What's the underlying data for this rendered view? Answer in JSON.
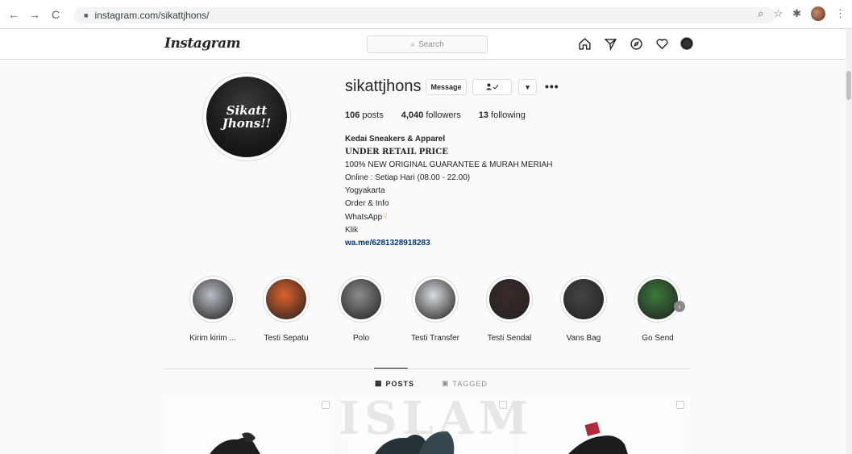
{
  "browser": {
    "url": "instagram.com/sikattjhons/"
  },
  "ig": {
    "logo": "Instagram",
    "search_placeholder": "Search"
  },
  "profile": {
    "username": "sikattjhons",
    "pic_text_line1": "Sikatt",
    "pic_text_line2": "Jhons!!",
    "message_label": "Message",
    "posts_count": "106",
    "posts_label": "posts",
    "followers_count": "4,040",
    "followers_label": "followers",
    "following_count": "13",
    "following_label": "following",
    "bio": {
      "name": "Kedai Sneakers & Apparel",
      "line1": "UNDER RETAIL PRICE",
      "line2": "100% NEW ORIGINAL GUARANTEE & MURAH MERIAH",
      "line3": "Online : Setiap Hari (08.00 - 22.00)",
      "line4": "Yogyakarta",
      "line5": "Order & Info",
      "line6": "WhatsApp",
      "line7": "Klik",
      "link": "wa.me/6281328918283"
    }
  },
  "highlights": [
    {
      "label": "Kirim kirim ...",
      "color": "#b9bec4"
    },
    {
      "label": "Testi Sepatu",
      "color": "#e0622b"
    },
    {
      "label": "Polo",
      "color": "#8d8d8d"
    },
    {
      "label": "Testi Transfer",
      "color": "#d9dcdf"
    },
    {
      "label": "Testi Sendal",
      "color": "#3b2a2a"
    },
    {
      "label": "Vans Bag",
      "color": "#454545"
    },
    {
      "label": "Go Send",
      "color": "#3a7a3a"
    }
  ],
  "tabs": {
    "posts": "POSTS",
    "tagged": "TAGGED"
  },
  "watermark": "ISLAM"
}
